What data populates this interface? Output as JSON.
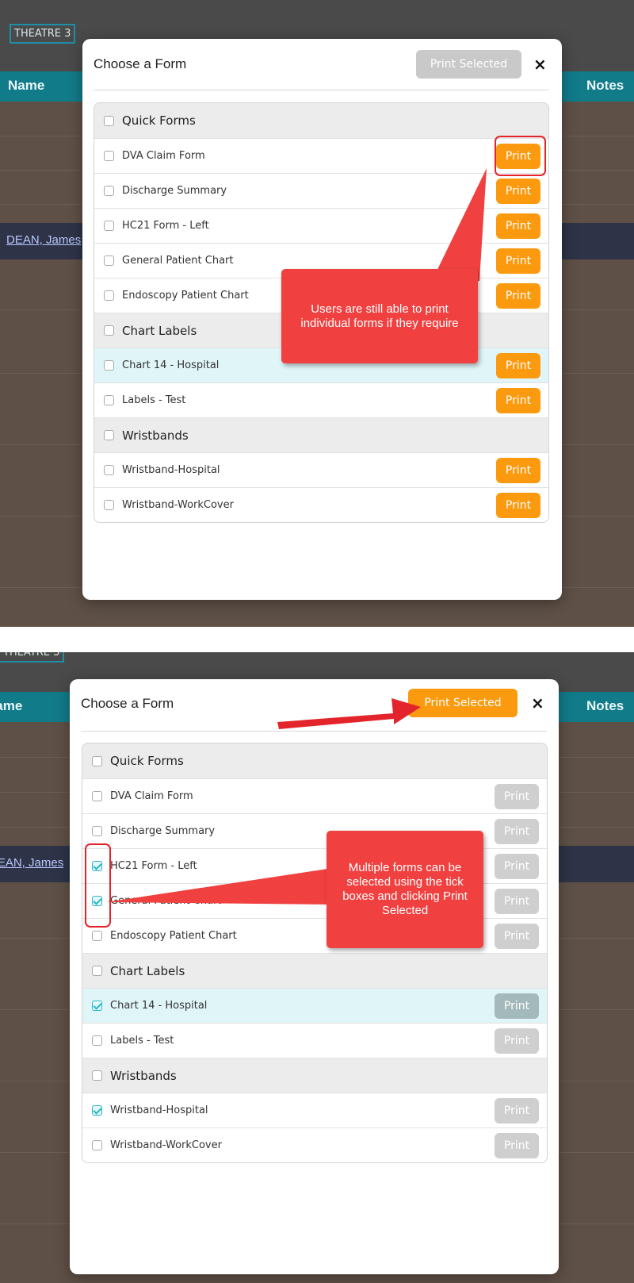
{
  "theatre_label": "THEATRE 3",
  "columns": {
    "name": "Name",
    "notes": "Notes"
  },
  "patient_name": "DEAN, James",
  "panels": [
    {
      "modal_title": "Choose a Form",
      "print_selected_label": "Print Selected",
      "close_symbol": "×",
      "callout": "Users are still able to print individual forms if they require",
      "rows": [
        {
          "label": "Quick Forms",
          "type": "group",
          "checked": false
        },
        {
          "label": "DVA Claim Form",
          "type": "item",
          "checked": false,
          "print": "Print"
        },
        {
          "label": "Discharge Summary",
          "type": "item",
          "checked": false,
          "print": "Print"
        },
        {
          "label": "HC21 Form - Left",
          "type": "item",
          "checked": false,
          "print": "Print"
        },
        {
          "label": "General Patient Chart",
          "type": "item",
          "checked": false,
          "print": "Print"
        },
        {
          "label": "Endoscopy Patient Chart",
          "type": "item",
          "checked": false,
          "print": "Print"
        },
        {
          "label": "Chart Labels",
          "type": "group",
          "checked": false
        },
        {
          "label": "Chart 14 - Hospital",
          "type": "item",
          "checked": false,
          "highlight": true,
          "print": "Print"
        },
        {
          "label": "Labels - Test",
          "type": "item",
          "checked": false,
          "print": "Print"
        },
        {
          "label": "Wristbands",
          "type": "group",
          "checked": false
        },
        {
          "label": "Wristband-Hospital",
          "type": "item",
          "checked": false,
          "print": "Print"
        },
        {
          "label": "Wristband-WorkCover",
          "type": "item",
          "checked": false,
          "print": "Print"
        }
      ]
    },
    {
      "modal_title": "Choose a Form",
      "print_selected_label": "Print Selected",
      "close_symbol": "×",
      "callout": "Multiple forms can be selected using the tick boxes and clicking Print Selected",
      "rows": [
        {
          "label": "Quick Forms",
          "type": "group",
          "checked": false
        },
        {
          "label": "DVA Claim Form",
          "type": "item",
          "checked": false,
          "print": "Print"
        },
        {
          "label": "Discharge Summary",
          "type": "item",
          "checked": false,
          "print": "Print"
        },
        {
          "label": "HC21 Form - Left",
          "type": "item",
          "checked": true,
          "print": "Print"
        },
        {
          "label": "General Patient Chart",
          "type": "item",
          "checked": true,
          "print": "Print"
        },
        {
          "label": "Endoscopy Patient Chart",
          "type": "item",
          "checked": false,
          "print": "Print"
        },
        {
          "label": "Chart Labels",
          "type": "group",
          "checked": false
        },
        {
          "label": "Chart 14 - Hospital",
          "type": "item",
          "checked": true,
          "highlight": true,
          "print": "Print"
        },
        {
          "label": "Labels - Test",
          "type": "item",
          "checked": false,
          "print": "Print"
        },
        {
          "label": "Wristbands",
          "type": "group",
          "checked": false
        },
        {
          "label": "Wristband-Hospital",
          "type": "item",
          "checked": true,
          "print": "Print"
        },
        {
          "label": "Wristband-WorkCover",
          "type": "item",
          "checked": false,
          "print": "Print"
        }
      ]
    }
  ],
  "colors": {
    "accent_orange": "#fb9a0e",
    "callout_red": "#f04040",
    "header_teal": "#117b8a",
    "check_teal": "#27b7c7"
  }
}
